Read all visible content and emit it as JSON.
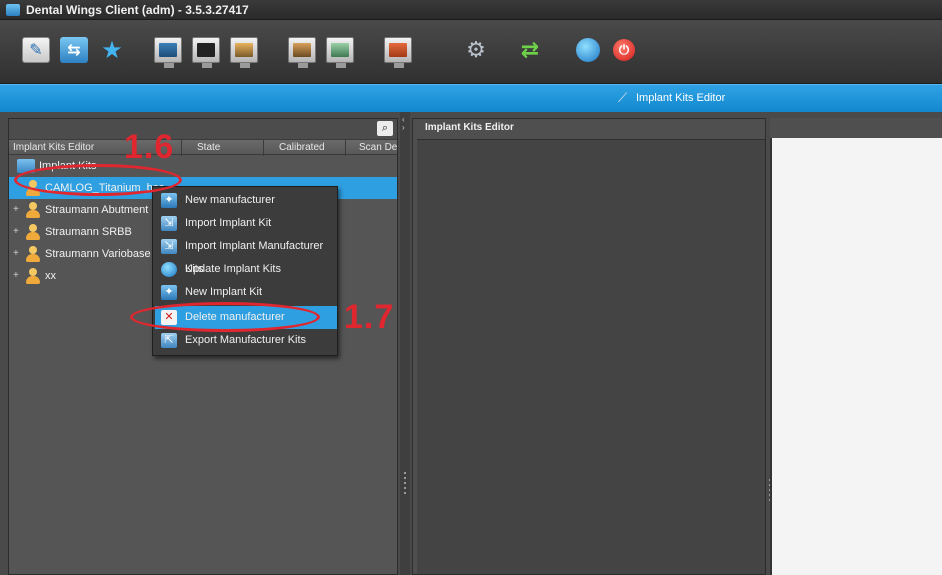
{
  "window": {
    "title": "Dental Wings Client (adm) - 3.5.3.27417"
  },
  "toolbar": {
    "icons": [
      "edit-icon",
      "open-case-icon",
      "favorites-star-icon",
      "monitor-1-icon",
      "monitor-2-icon",
      "monitor-3-icon",
      "monitor-4-icon",
      "monitor-5-icon",
      "monitor-6-icon",
      "settings-gears-icon",
      "sync-arrows-icon",
      "globe-icon",
      "power-icon"
    ]
  },
  "header_strip": {
    "label": "Implant Kits Editor"
  },
  "left_panel": {
    "columns": [
      "Implant Kits Editor",
      "State",
      "Calibrated",
      "Scan Devi"
    ],
    "tree": {
      "root": "Implant Kits",
      "items": [
        {
          "label": "CAMLOG_Titanium_bas",
          "selected": true
        },
        {
          "label": "Straumann Abutment",
          "selected": false
        },
        {
          "label": "Straumann SRBB",
          "selected": false
        },
        {
          "label": "Straumann Variobase A",
          "selected": false
        },
        {
          "label": "xx",
          "selected": false
        }
      ]
    }
  },
  "middle_panel": {
    "title": "Implant Kits Editor"
  },
  "context_menu": {
    "items": [
      {
        "label": "New manufacturer",
        "icon": "new-manufacturer-icon",
        "highlighted": false
      },
      {
        "label": "Import Implant Kit",
        "icon": "import-kit-icon",
        "highlighted": false
      },
      {
        "label": "Import Implant Manufacturer Kits",
        "icon": "import-manufacturer-icon",
        "highlighted": false
      },
      {
        "label": "Update Implant Kits",
        "icon": "update-globe-icon",
        "highlighted": false
      },
      {
        "label": "New Implant Kit",
        "icon": "new-kit-icon",
        "highlighted": false
      },
      {
        "label": "Delete manufacturer",
        "icon": "delete-x-icon",
        "highlighted": true
      },
      {
        "label": "Export Manufacturer Kits",
        "icon": "export-icon",
        "highlighted": false
      }
    ]
  },
  "annotations": {
    "step_a": "1.6",
    "step_b": "1.7",
    "color": "#e0262e"
  },
  "colors": {
    "accent_blue": "#2e9fe0",
    "panel_dark": "#4a4a4a"
  }
}
